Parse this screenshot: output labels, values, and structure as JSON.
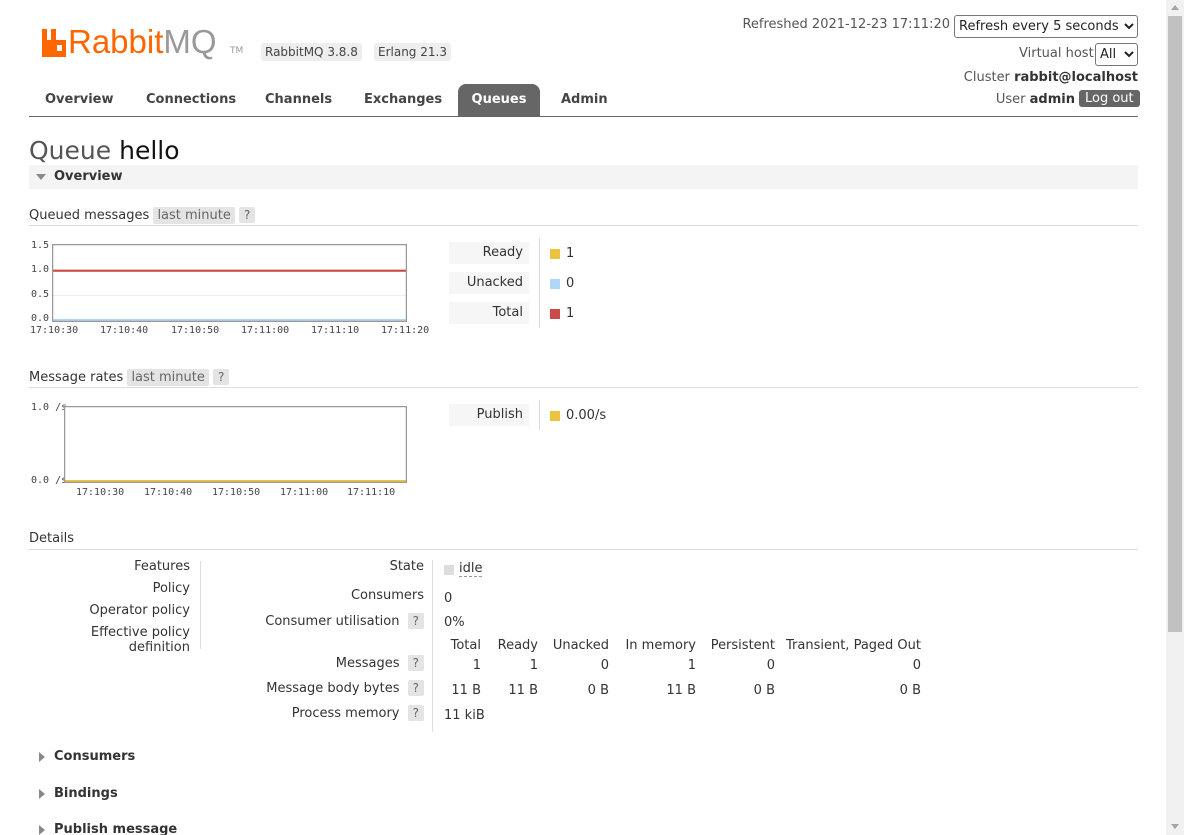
{
  "logo": {
    "text_rabbit": "Rabbit",
    "text_mq": "MQ",
    "tm": "TM"
  },
  "header": {
    "version": "RabbitMQ 3.8.8",
    "erlang": "Erlang 21.3",
    "refreshed_label": "Refreshed",
    "refreshed_time": "2021-12-23 17:11:20",
    "refresh_select": "Refresh every 5 seconds",
    "vhost_label": "Virtual host",
    "vhost_value": "All",
    "cluster_label": "Cluster",
    "cluster_value": "rabbit@localhost",
    "user_label": "User",
    "user_value": "admin",
    "logout": "Log out"
  },
  "tabs": [
    "Overview",
    "Connections",
    "Channels",
    "Exchanges",
    "Queues",
    "Admin"
  ],
  "active_tab": "Queues",
  "page": {
    "title_prefix": "Queue",
    "title_name": "hello",
    "overview_section": "Overview"
  },
  "queued_messages": {
    "label": "Queued messages",
    "range": "last minute",
    "help": "?",
    "legend": [
      {
        "label": "Ready",
        "value": "1",
        "color": "#edc240"
      },
      {
        "label": "Unacked",
        "value": "0",
        "color": "#afd8f8"
      },
      {
        "label": "Total",
        "value": "1",
        "color": "#cb4b4b"
      }
    ]
  },
  "message_rates": {
    "label": "Message rates",
    "range": "last minute",
    "help": "?",
    "legend": [
      {
        "label": "Publish",
        "value": "0.00/s",
        "color": "#edc240"
      }
    ]
  },
  "chart_data": [
    {
      "type": "line",
      "yticks": [
        "1.5",
        "1.0",
        "0.5",
        "0.0"
      ],
      "xticks": [
        "17:10:30",
        "17:10:40",
        "17:10:50",
        "17:11:00",
        "17:11:10",
        "17:11:20"
      ],
      "ylim": [
        0,
        1.5
      ],
      "series": [
        {
          "name": "Ready",
          "color": "#edc240",
          "values": [
            1,
            1,
            1,
            1,
            1,
            1
          ]
        },
        {
          "name": "Unacked",
          "color": "#afd8f8",
          "values": [
            0,
            0,
            0,
            0,
            0,
            0
          ]
        },
        {
          "name": "Total",
          "color": "#cb4b4b",
          "values": [
            1,
            1,
            1,
            1,
            1,
            1
          ]
        }
      ]
    },
    {
      "type": "line",
      "yticks": [
        "1.0 /s",
        "0.0 /s"
      ],
      "xticks": [
        "17:10:30",
        "17:10:40",
        "17:10:50",
        "17:11:00",
        "17:11:10"
      ],
      "ylim": [
        0,
        1.0
      ],
      "series": [
        {
          "name": "Publish",
          "color": "#edc240",
          "values": [
            0,
            0,
            0,
            0,
            0,
            0
          ]
        }
      ]
    }
  ],
  "details": {
    "label": "Details",
    "left_labels": [
      "Features",
      "Policy",
      "Operator policy",
      "Effective policy definition"
    ],
    "state_label": "State",
    "state_value": "idle",
    "consumers_label": "Consumers",
    "consumers_value": "0",
    "utilisation_label": "Consumer utilisation",
    "utilisation_value": "0%",
    "help": "?",
    "table": {
      "headers": [
        "Total",
        "Ready",
        "Unacked",
        "In memory",
        "Persistent",
        "Transient, Paged Out"
      ],
      "rows": [
        {
          "label": "Messages",
          "values": [
            "1",
            "1",
            "0",
            "1",
            "0",
            "0"
          ]
        },
        {
          "label": "Message body bytes",
          "values": [
            "11 B",
            "11 B",
            "0 B",
            "11 B",
            "0 B",
            "0 B"
          ]
        }
      ],
      "process_memory_label": "Process memory",
      "process_memory_value": "11 kiB"
    }
  },
  "collapsed_sections": [
    "Consumers",
    "Bindings",
    "Publish message"
  ]
}
